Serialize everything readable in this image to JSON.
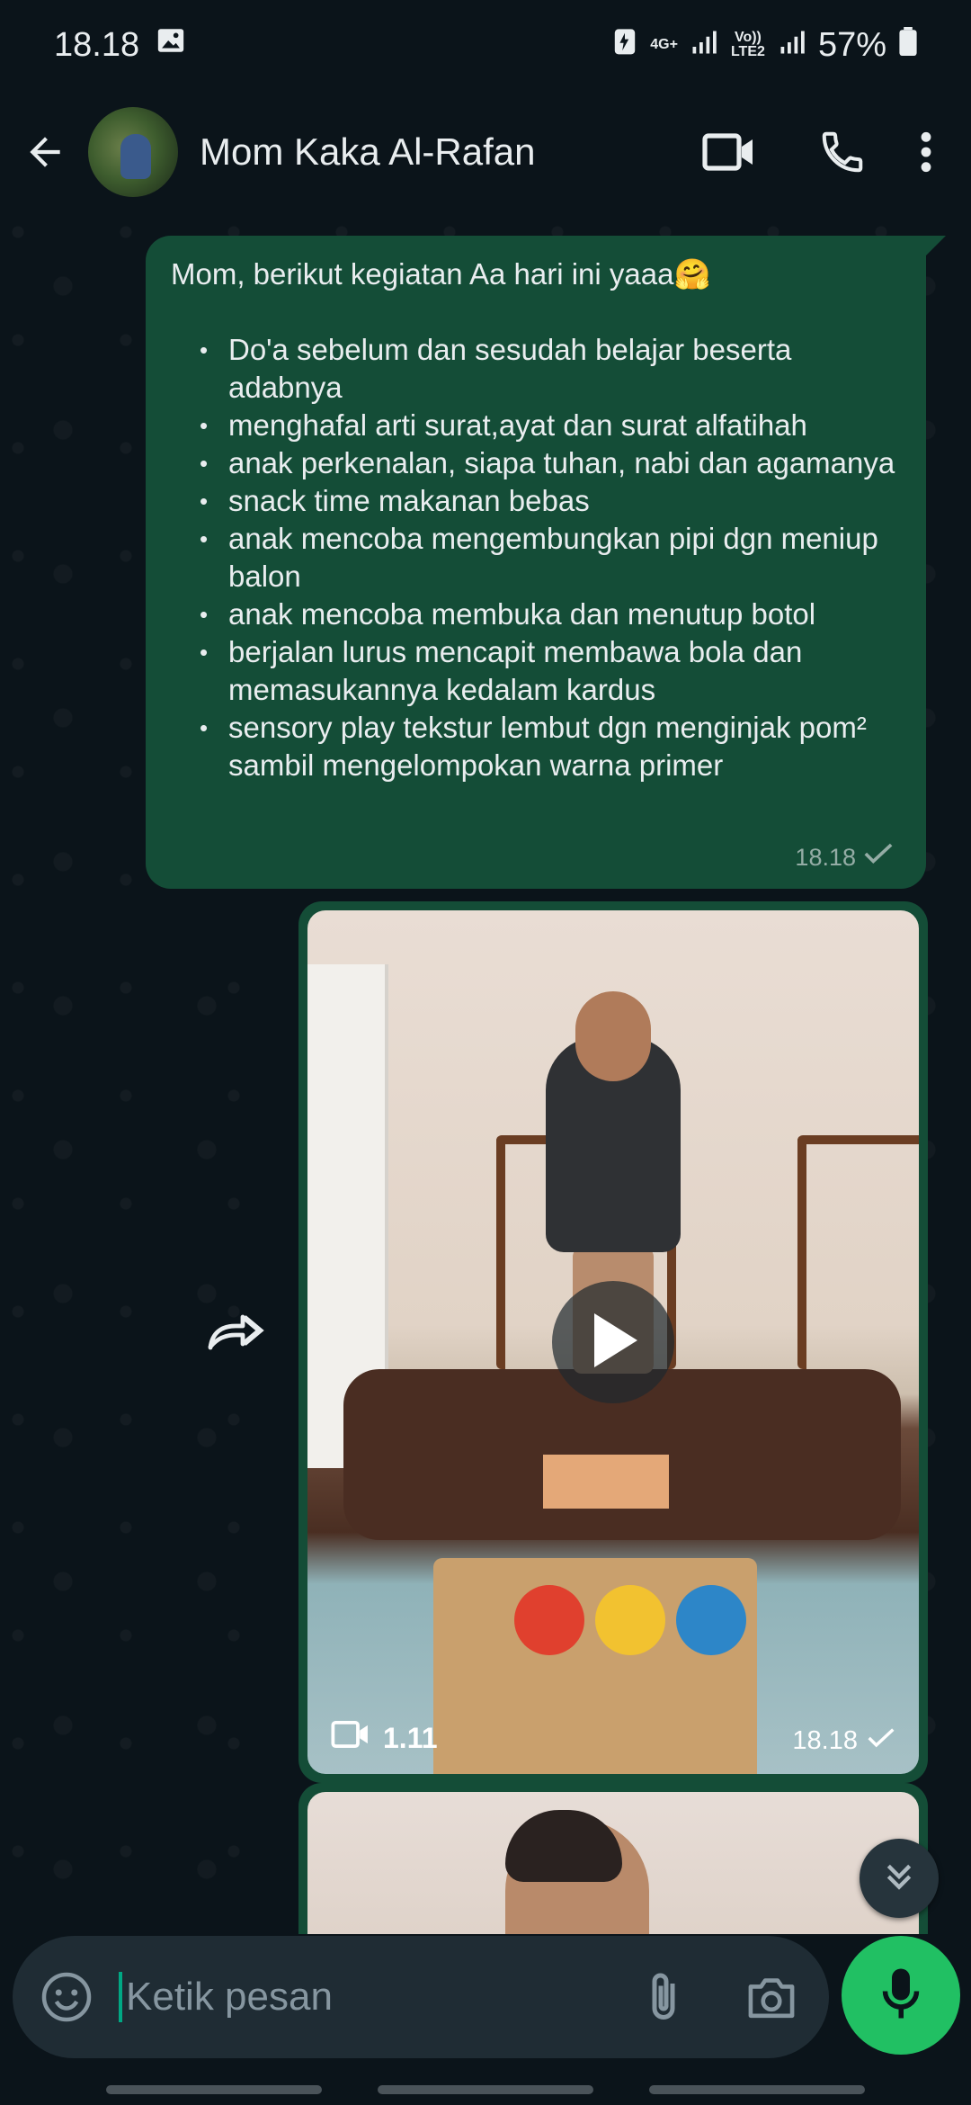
{
  "status_bar": {
    "time": "18.18",
    "network_top": "4G+",
    "network_bottom": "Vo)) LTE2",
    "battery": "57%"
  },
  "header": {
    "contact_name": "Mom Kaka Al-Rafan"
  },
  "messages": {
    "text_message": {
      "intro": "Mom, berikut kegiatan Aa hari ini  yaaa🤗",
      "items": [
        "Do'a sebelum dan sesudah belajar beserta adabnya",
        "menghafal arti surat,ayat dan surat alfatihah",
        "anak perkenalan, siapa tuhan, nabi dan agamanya",
        "snack time makanan bebas",
        "anak mencoba mengembungkan pipi dgn meniup balon",
        "anak mencoba membuka dan menutup botol",
        "berjalan lurus mencapit membawa bola dan memasukannya kedalam kardus",
        "sensory play tekstur lembut dgn menginjak pom² sambil mengelompokan warna primer"
      ],
      "time": "18.18"
    },
    "video_message": {
      "duration": "1.11",
      "time": "18.18"
    }
  },
  "input": {
    "placeholder": "Ketik pesan"
  },
  "colors": {
    "outgoing_bubble": "#144d37",
    "background": "#0b141a",
    "accent_green": "#21c063"
  }
}
